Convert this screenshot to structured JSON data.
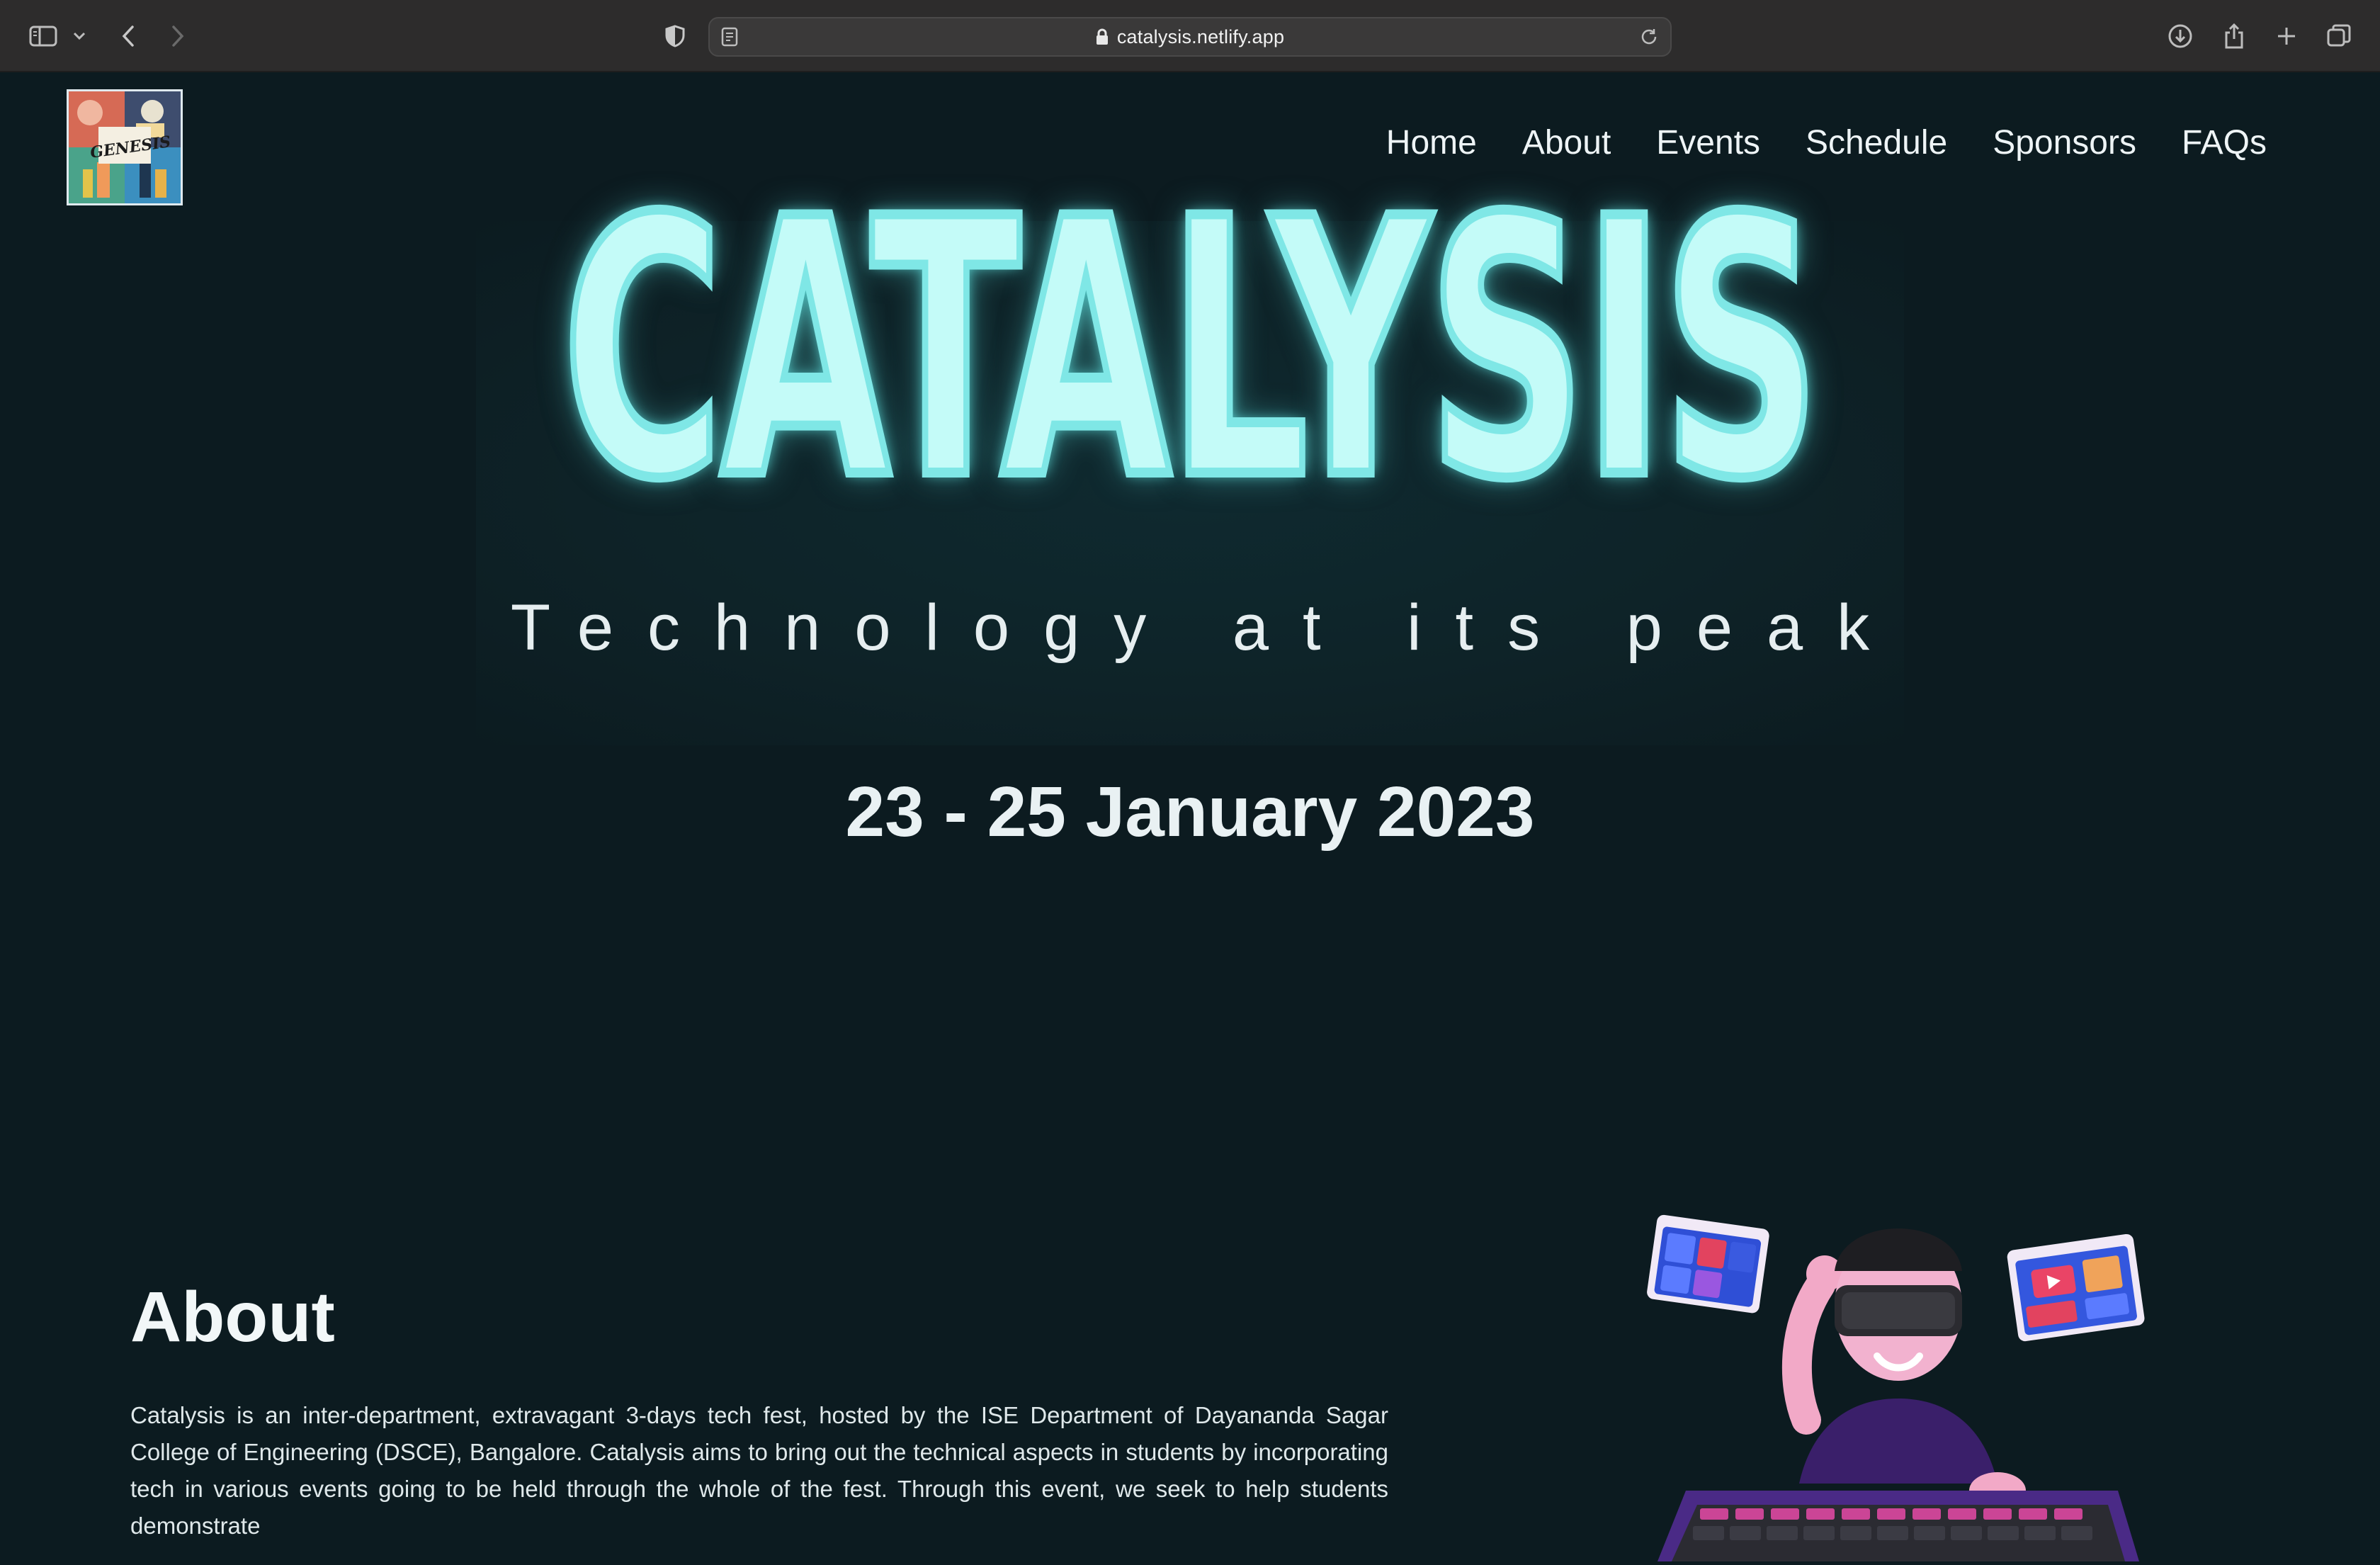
{
  "browser": {
    "url": "catalysis.netlify.app",
    "icons": [
      "sidebar-toggle-icon",
      "chevron-down-icon",
      "back-icon",
      "forward-icon",
      "privacy-shield-icon",
      "reader-icon",
      "lock-icon",
      "reload-icon",
      "download-icon",
      "share-icon",
      "new-tab-icon",
      "tab-overview-icon"
    ]
  },
  "header": {
    "logo_text": "GENESIS",
    "nav": [
      "Home",
      "About",
      "Events",
      "Schedule",
      "Sponsors",
      "FAQs"
    ]
  },
  "hero": {
    "title": "CATALYSIS",
    "tagline": "Technology at its peak",
    "dates": "23 - 25 January 2023"
  },
  "about": {
    "heading": "About",
    "body": "Catalysis is an inter-department, extravagant 3-days tech fest, hosted by the ISE Department of Dayananda Sagar College of Engineering (DSCE), Bangalore. Catalysis aims to bring out the technical aspects in students by incorporating tech in various events going to be held through the whole of the fest. Through this event, we seek to help students demonstrate"
  },
  "colors": {
    "background": "#0c1b20",
    "neon": "#c4fbf8",
    "neon_glow": "#7fe7e6",
    "chrome": "#2d2c2c"
  }
}
